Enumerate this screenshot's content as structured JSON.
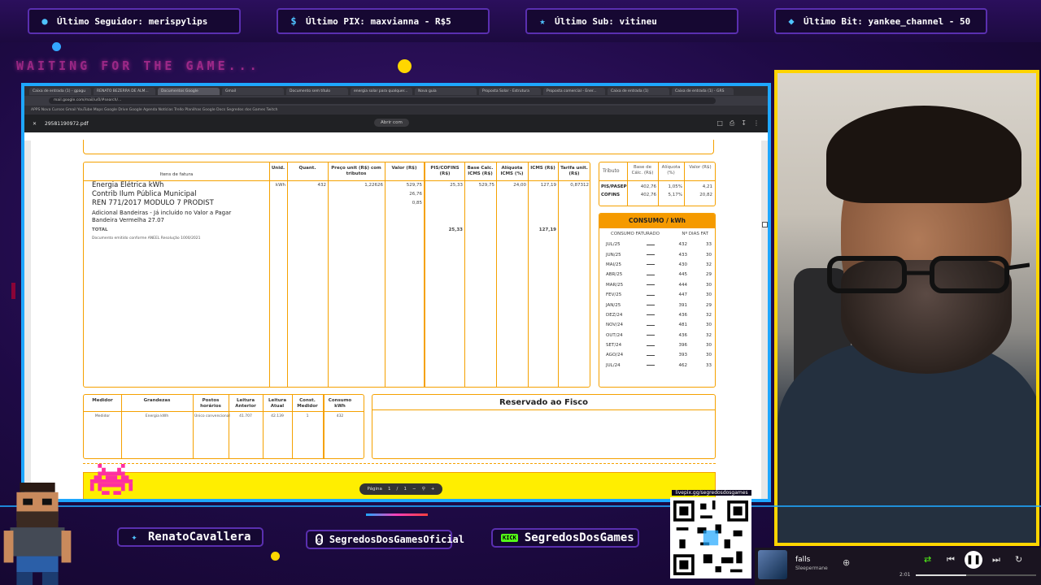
{
  "overlay": {
    "alerts": [
      {
        "label": "Último Seguidor: merispylips",
        "icon": "user-icon"
      },
      {
        "label": "Último PIX: maxvianna - R$5",
        "icon": "dollar-icon"
      },
      {
        "label": "Último Sub: vitineu",
        "icon": "star-icon"
      },
      {
        "label": "Último Bit: yankee_channel - 50",
        "icon": "diamond-icon"
      }
    ],
    "waiting_text": "WAITING FOR THE GAME...",
    "socials": [
      {
        "label": "RenatoCavallera",
        "icon": "twitter-icon"
      },
      {
        "label": "SegredosDosGamesOficial",
        "icon": "instagram-icon"
      },
      {
        "label": "SegredosDosGames",
        "icon": "kick-icon",
        "badge": "KICK"
      }
    ],
    "qr_label": "livepix.gg/segredosdosgames",
    "colors": {
      "accent": "#1ea7ff",
      "border": "#ffd400",
      "neon": "#ff3fb8"
    }
  },
  "browser": {
    "tabs": [
      "Caixa de entrada (1) - gpagu",
      "RENATO BEZERRA DE ALM...",
      "Documentos Google",
      "Gmail",
      "Documento sem título",
      "energia solar para qualquer...",
      "Nova guia",
      "Proposta Solar - Estrutura",
      "Proposta comercial - Ener...",
      "Caixa de entrada (1)",
      "Caixa de entrada (1) - GRS"
    ],
    "url": "mail.google.com/mail/u/0/#search/...",
    "bookmarks": "APPS  Nova  Cursos  Gmail  YouTube  Maps  Google Drive  Google Agenda  Notícias  Trello  Planilhas  Google Docs  Segredos dos Games  Twitch",
    "pdf_filename": "29581190972.pdf",
    "open_with": "Abrir com",
    "pager": {
      "label": "Página",
      "current": "1",
      "sep": "/",
      "total": "1"
    }
  },
  "invoice": {
    "headers": [
      "Itens de fatura",
      "Unid.",
      "Quant.",
      "Preço unit (R$) com tributos",
      "Valor (R$)",
      "PIS/COFINS (R$)",
      "Base Calc. ICMS (R$)",
      "Alíquota ICMS (%)",
      "ICMS (R$)",
      "Tarifa unit. (R$)"
    ],
    "items": [
      {
        "desc": "Energia Elétrica kWh",
        "unid": "kWh",
        "quant": "432",
        "preco": "1,22626",
        "valor": "529,75",
        "pis": "25,33",
        "base": "529,75",
        "aliq": "24,00",
        "icms": "127,19",
        "tarifa": "0,87312"
      },
      {
        "desc": "Contrib Ilum Pública Municipal",
        "valor": "26,76"
      },
      {
        "desc": "REN 771/2017 MODULO 7 PRODIST",
        "valor": "0,85"
      },
      {
        "desc": "Adicional Bandeiras - Já incluído no Valor a Pagar"
      },
      {
        "desc": "Bandeira Vermelha 27.07"
      }
    ],
    "total_label": "TOTAL",
    "total_pis": "25,33",
    "total_icms": "127,19",
    "note": "Documento emitido conforme ANEEL Resolução 1000/2021",
    "tributos": {
      "headers": [
        "Tributo",
        "Base de Cálc. (R$)",
        "Alíquota (%)",
        "Valor (R$)"
      ],
      "rows": [
        [
          "PIS/PASEP",
          "402,76",
          "1,05%",
          "4,21"
        ],
        [
          "COFINS",
          "402,76",
          "5,17%",
          "20,82"
        ]
      ]
    },
    "consumo": {
      "title": "CONSUMO / kWh",
      "col1": "CONSUMO FATURADO",
      "col2": "Nº DIAS FAT",
      "rows": [
        {
          "mes": "JUL/25",
          "kwh": "432",
          "dias": "33"
        },
        {
          "mes": "JUN/25",
          "kwh": "433",
          "dias": "30"
        },
        {
          "mes": "MAI/25",
          "kwh": "430",
          "dias": "32"
        },
        {
          "mes": "ABR/25",
          "kwh": "445",
          "dias": "29"
        },
        {
          "mes": "MAR/25",
          "kwh": "444",
          "dias": "30"
        },
        {
          "mes": "FEV/25",
          "kwh": "447",
          "dias": "30"
        },
        {
          "mes": "JAN/25",
          "kwh": "391",
          "dias": "29"
        },
        {
          "mes": "DEZ/24",
          "kwh": "436",
          "dias": "32"
        },
        {
          "mes": "NOV/24",
          "kwh": "481",
          "dias": "30"
        },
        {
          "mes": "OUT/24",
          "kwh": "436",
          "dias": "32"
        },
        {
          "mes": "SET/24",
          "kwh": "396",
          "dias": "30"
        },
        {
          "mes": "AGO/24",
          "kwh": "393",
          "dias": "30"
        },
        {
          "mes": "JUL/24",
          "kwh": "462",
          "dias": "33"
        }
      ]
    },
    "medidor": {
      "headers": [
        "Medidor",
        "Grandezas",
        "Postos horários",
        "Leitura Anterior",
        "Leitura Atual",
        "Const. Medidor",
        "Consumo kWh"
      ],
      "row": [
        "Medidor",
        "Energia kWh",
        "Único convencional",
        "41.707",
        "42.139",
        "1",
        "432"
      ]
    },
    "fisco_title": "Reservado ao Fisco"
  },
  "player": {
    "song": "falls",
    "artist": "Sleepermane",
    "time": "2:01",
    "progress": 0.42
  }
}
